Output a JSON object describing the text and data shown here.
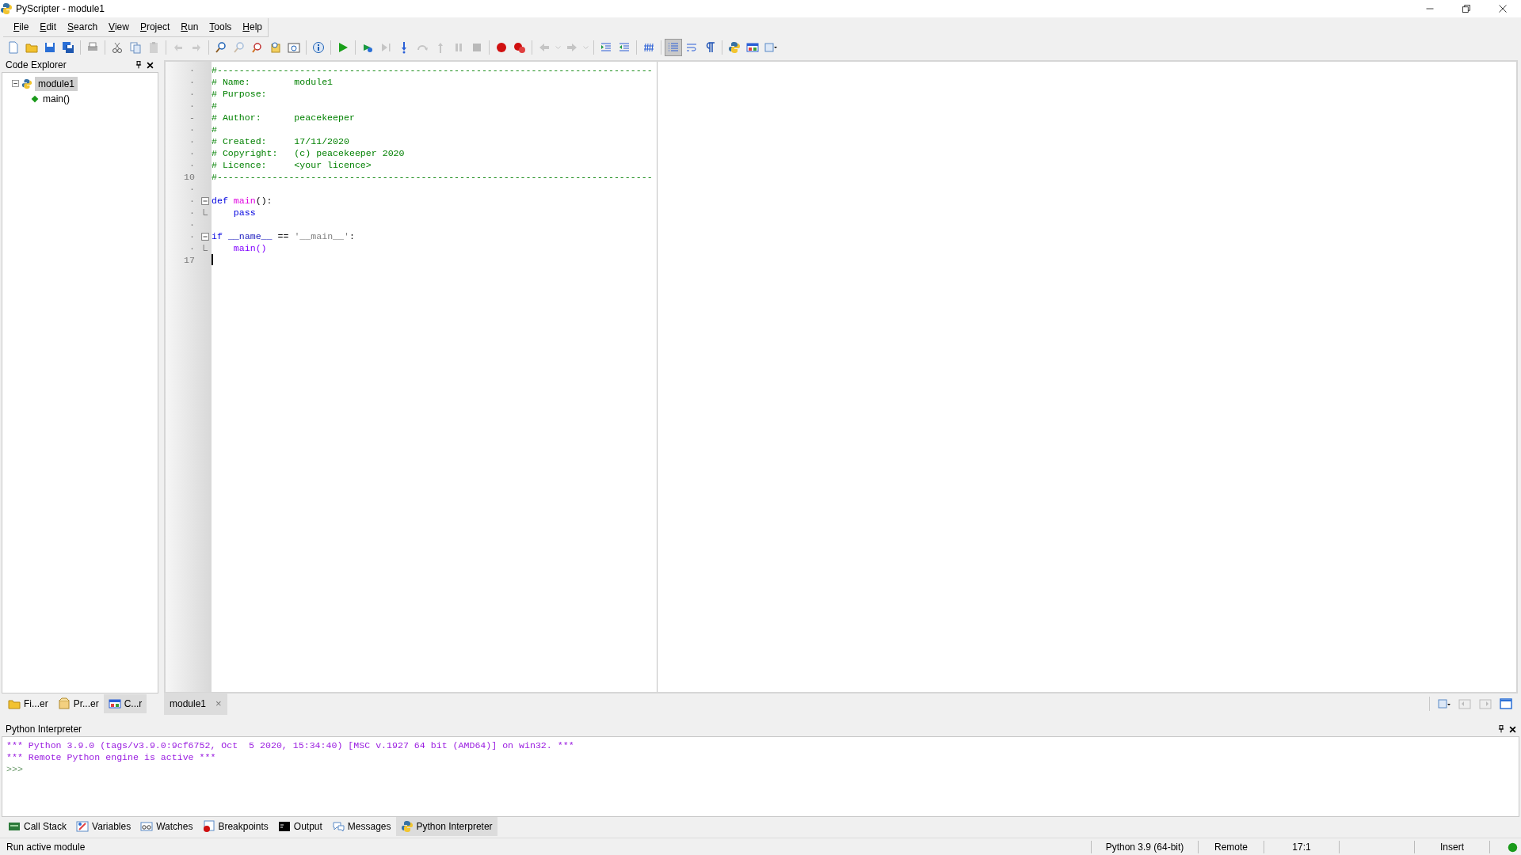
{
  "window": {
    "title": "PyScripter - module1"
  },
  "menu": [
    {
      "label": "File"
    },
    {
      "label": "Edit"
    },
    {
      "label": "Search"
    },
    {
      "label": "View"
    },
    {
      "label": "Project"
    },
    {
      "label": "Run"
    },
    {
      "label": "Tools"
    },
    {
      "label": "Help"
    }
  ],
  "toolbar": [
    {
      "kind": "new",
      "disabled": false
    },
    {
      "kind": "open",
      "disabled": false
    },
    {
      "kind": "save",
      "disabled": false
    },
    {
      "kind": "saveall",
      "disabled": false
    },
    {
      "kind": "sep"
    },
    {
      "kind": "print",
      "disabled": false
    },
    {
      "kind": "sep"
    },
    {
      "kind": "cut",
      "disabled": false
    },
    {
      "kind": "copy",
      "disabled": false
    },
    {
      "kind": "paste",
      "disabled": true
    },
    {
      "kind": "sep"
    },
    {
      "kind": "undo",
      "disabled": true
    },
    {
      "kind": "redo",
      "disabled": true
    },
    {
      "kind": "sep"
    },
    {
      "kind": "find",
      "disabled": false
    },
    {
      "kind": "find",
      "disabled": true
    },
    {
      "kind": "replace",
      "disabled": false
    },
    {
      "kind": "goto",
      "disabled": false
    },
    {
      "kind": "window",
      "disabled": false
    },
    {
      "kind": "sep"
    },
    {
      "kind": "info",
      "disabled": false
    },
    {
      "kind": "sep"
    },
    {
      "kind": "run",
      "disabled": false
    },
    {
      "kind": "sep"
    },
    {
      "kind": "debug",
      "disabled": false
    },
    {
      "kind": "runto",
      "disabled": true
    },
    {
      "kind": "stepinto",
      "disabled": false
    },
    {
      "kind": "stepover",
      "disabled": true
    },
    {
      "kind": "stepout",
      "disabled": true
    },
    {
      "kind": "pause",
      "disabled": true
    },
    {
      "kind": "stop",
      "disabled": true
    },
    {
      "kind": "sep"
    },
    {
      "kind": "breakpoint",
      "disabled": false
    },
    {
      "kind": "clearbp",
      "disabled": false
    },
    {
      "kind": "sep"
    },
    {
      "kind": "back",
      "disabled": true
    },
    {
      "kind": "drop",
      "disabled": true
    },
    {
      "kind": "forward",
      "disabled": true
    },
    {
      "kind": "drop",
      "disabled": true
    },
    {
      "kind": "sep"
    },
    {
      "kind": "indent",
      "disabled": false
    },
    {
      "kind": "dedent",
      "disabled": false
    },
    {
      "kind": "sep"
    },
    {
      "kind": "comment",
      "disabled": false
    },
    {
      "kind": "sep"
    },
    {
      "kind": "lines",
      "disabled": false,
      "on": true
    },
    {
      "kind": "wrap",
      "disabled": false,
      "on": false
    },
    {
      "kind": "pilcrow",
      "disabled": false,
      "on": false
    },
    {
      "kind": "sep"
    },
    {
      "kind": "python",
      "disabled": false
    },
    {
      "kind": "layout",
      "disabled": false
    },
    {
      "kind": "view",
      "disabled": false
    }
  ],
  "code_explorer": {
    "title": "Code Explorer",
    "tree": [
      {
        "label": "module1",
        "selected": true,
        "expanded": true,
        "children": [
          {
            "label": "main()",
            "selected": false
          }
        ]
      }
    ]
  },
  "left_tabs": [
    {
      "label": "Fi...er",
      "selected": false
    },
    {
      "label": "Pr...er",
      "selected": false
    },
    {
      "label": "C...r",
      "selected": true
    }
  ],
  "editor": {
    "lines": [
      {
        "gutter": "·",
        "tokens": [
          {
            "kind": "comment",
            "text": "#-------------------------------------------------------------------------------"
          }
        ]
      },
      {
        "gutter": "·",
        "tokens": [
          {
            "kind": "comment",
            "text": "# Name:        module1"
          }
        ]
      },
      {
        "gutter": "·",
        "tokens": [
          {
            "kind": "comment",
            "text": "# Purpose:"
          }
        ]
      },
      {
        "gutter": "·",
        "tokens": [
          {
            "kind": "comment",
            "text": "#"
          }
        ]
      },
      {
        "gutter": "-",
        "tokens": [
          {
            "kind": "comment",
            "text": "# Author:      peacekeeper"
          }
        ]
      },
      {
        "gutter": "·",
        "tokens": [
          {
            "kind": "comment",
            "text": "#"
          }
        ]
      },
      {
        "gutter": "·",
        "tokens": [
          {
            "kind": "comment",
            "text": "# Created:     17/11/2020"
          }
        ]
      },
      {
        "gutter": "·",
        "tokens": [
          {
            "kind": "comment",
            "text": "# Copyright:   (c) peacekeeper 2020"
          }
        ]
      },
      {
        "gutter": "·",
        "tokens": [
          {
            "kind": "comment",
            "text": "# Licence:     <your licence>"
          }
        ]
      },
      {
        "gutter": "10",
        "tokens": [
          {
            "kind": "comment",
            "text": "#-------------------------------------------------------------------------------"
          }
        ]
      },
      {
        "gutter": "·"
      },
      {
        "gutter": "·",
        "fold_start": true,
        "tokens": [
          {
            "kind": "keyword",
            "text": "def"
          },
          {
            "kind": "funcname",
            "text": "main",
            "gap": true
          },
          {
            "kind": "plain",
            "text": "():"
          }
        ]
      },
      {
        "gutter": "·",
        "fold_end": true,
        "indented": true,
        "tokens": [
          {
            "kind": "keyword",
            "text": "pass"
          }
        ]
      },
      {
        "gutter": "·"
      },
      {
        "gutter": "·",
        "fold_start": true,
        "tokens": [
          {
            "kind": "keyword",
            "text": "if"
          },
          {
            "kind": "special",
            "text": "__name__",
            "gap": true
          },
          {
            "kind": "plain",
            "text": " == "
          },
          {
            "kind": "string",
            "text": "'__main__'"
          },
          {
            "kind": "plain",
            "text": ":"
          }
        ]
      },
      {
        "gutter": "·",
        "fold_end": true,
        "indented": true,
        "tokens": [
          {
            "kind": "call",
            "text": "main()"
          }
        ]
      },
      {
        "gutter": "17",
        "cursor": true
      }
    ]
  },
  "editor_tabs": [
    {
      "label": "module1",
      "selected": true,
      "close": "×"
    }
  ],
  "interpreter": {
    "title": "Python Interpreter",
    "lines": [
      {
        "kind": "banner",
        "text": "*** Python 3.9.0 (tags/v3.9.0:9cf6752, Oct  5 2020, 15:34:40) [MSC v.1927 64 bit (AMD64)] on win32. ***"
      },
      {
        "kind": "banner",
        "text": "*** Remote Python engine is active ***"
      },
      {
        "kind": "prompt",
        "text": ">>>"
      }
    ]
  },
  "bottom_tabs": [
    {
      "label": "Call Stack",
      "selected": false
    },
    {
      "label": "Variables",
      "selected": false
    },
    {
      "label": "Watches",
      "selected": false
    },
    {
      "label": "Breakpoints",
      "selected": false
    },
    {
      "label": "Output",
      "selected": false
    },
    {
      "label": "Messages",
      "selected": false
    },
    {
      "label": "Python Interpreter",
      "selected": true
    }
  ],
  "status_bar": {
    "hint": "Run active module",
    "panels": [
      {
        "text": "Python 3.9 (64-bit)"
      },
      {
        "text": "Remote"
      },
      {
        "text": "17:1"
      },
      {
        "text": "Insert",
        "gap_before": true
      }
    ]
  }
}
